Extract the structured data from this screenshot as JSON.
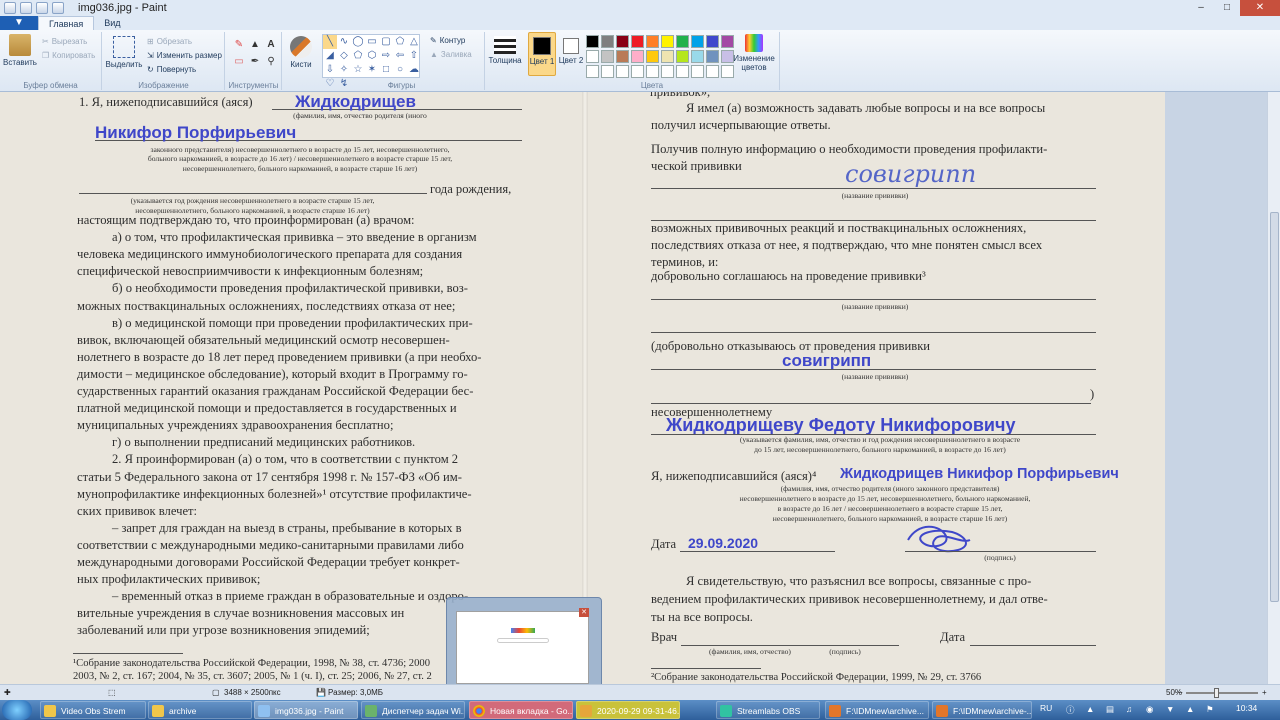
{
  "window": {
    "title": "img036.jpg - Paint",
    "tabs": [
      "Главная",
      "Вид"
    ]
  },
  "ribbon": {
    "clipboard": {
      "paste": "Вставить",
      "cut": "Вырезать",
      "copy": "Копировать",
      "label": "Буфер обмена"
    },
    "image": {
      "select": "Выделить",
      "crop": "Обрезать",
      "resize": "Изменить размер",
      "rotate": "Повернуть",
      "label": "Изображение"
    },
    "tools": {
      "label": "Инструменты"
    },
    "brushes": {
      "label": "Кисти"
    },
    "shapes": {
      "outline": "Контур",
      "fill": "Заливка",
      "label": "Фигуры"
    },
    "size": {
      "label": "Толщина"
    },
    "colors": {
      "color1": "Цвет 1",
      "color2": "Цвет 2",
      "edit": "Изменение цветов",
      "label": "Цвета"
    },
    "palette": [
      "#000000",
      "#7f7f7f",
      "#880015",
      "#ed1c24",
      "#ff7f27",
      "#fff200",
      "#22b14c",
      "#00a2e8",
      "#3f48cc",
      "#a349a4",
      "#ffffff",
      "#c3c3c3",
      "#b97a57",
      "#ffaec9",
      "#ffc90e",
      "#efe4b0",
      "#b5e61d",
      "#99d9ea",
      "#7092be",
      "#c8bfe7",
      "#ffffff",
      "#ffffff",
      "#ffffff",
      "#ffffff",
      "#ffffff",
      "#ffffff",
      "#ffffff",
      "#ffffff",
      "#ffffff",
      "#ffffff"
    ]
  },
  "document": {
    "left": {
      "line1": "1. Я, нижеподписавшийся (аяся)",
      "hw_surname": "Жидкодрищев",
      "hw_name": "Никифор  Порфирьевич",
      "cap1a": "(фамилия, имя, отчество родителя (иного",
      "cap1b": "законного представителя) несовершеннолетнего в возрасте до 15 лет, несовершеннолетнего,",
      "cap1c": "больного наркоманией, в возрасте до 16 лет) / несовершеннолетнего в возрасте старше 15 лет,",
      "cap1d": "несовершеннолетнего, больного наркоманией, в возрасте старше 16 лет)",
      "birth": "года рождения,",
      "cap2a": "(указывается год рождения несовершеннолетнего в возрасте старше 15 лет,",
      "cap2b": "несовершеннолетнего, больного наркоманией, в возрасте старше 16 лет)",
      "body": [
        "настоящим подтверждаю то, что проинформирован (а) врачом:",
        "а) о том, что профилактическая прививка – это введение в организм",
        "человека медицинского иммунобиологического препарата для создания",
        "специфической невосприимчивости к инфекционным болезням;",
        "б) о необходимости проведения профилактической прививки, воз-",
        "можных поствакцинальных осложнениях, последствиях отказа от нее;",
        "в) о медицинской помощи при проведении профилактических при-",
        "вивок, включающей обязательный медицинский осмотр несовершен-",
        "нолетнего в возрасте до 18 лет перед проведением прививки (а при необхо-",
        "димости – медицинское обследование), который входит в Программу го-",
        "сударственных гарантий оказания гражданам Российской Федерации бес-",
        "платной медицинской помощи и предоставляется в государственных и",
        "муниципальных учреждениях здравоохранения бесплатно;",
        "г) о выполнении предписаний медицинских работников.",
        "2. Я проинформирован (а) о том, что в соответствии с пунктом 2",
        "статьи 5 Федерального закона от 17 сентября 1998 г. № 157-ФЗ «Об им-",
        "мунопрофилактике инфекционных болезней»¹ отсутствие профилактиче-",
        "ских прививок влечет:",
        "– запрет для граждан на выезд в страны, пребывание в которых в",
        "соответствии с международными медико-санитарными правилами либо",
        "международными договорами Российской Федерации требует конкрет-",
        "ных профилактических прививок;",
        "– временный отказ в приеме граждан в образовательные и оздоро-",
        "вительные учреждения в случае возникновения массовых ин",
        "заболеваний или при угрозе возникновения эпидемий;"
      ],
      "foot1": "¹Собрание законодательства Российской Федерации, 1998, № 38, ст. 4736; 2000",
      "foot2": "2003, № 2, ст. 167; 2004, № 35, ст. 3607; 2005, № 1 (ч. I), ст. 25; 2006, № 27, ст. 2"
    },
    "right": {
      "top": "прививок»,",
      "p1a": "Я имел (а) возможность задавать любые вопросы и на все вопросы",
      "p1b": "получил исчерпывающие ответы.",
      "p2a": "Получив полную информацию о необходимости проведения профилакти-",
      "p2b": "ческой прививки",
      "hw_vaccine1": "совигрипп",
      "vac_cap": "(название прививки)",
      "p3a": "возможных прививочных реакций и поствакцинальных осложнениях,",
      "p3b": "последствиях отказа от нее, я подтверждаю, что мне понятен смысл всех",
      "p3c": "терминов, и:",
      "p3d": "добровольно соглашаюсь на проведение прививки³",
      "refuse": "(добровольно отказываюсь от проведения прививки",
      "hw_vaccine2": "совигрипп",
      "close_paren": ")",
      "minor": "несовершеннолетнему",
      "hw_child": "Жидкодрищеву Федоту Никифоровичу",
      "cap_child1": "(указывается фамилия, имя, отчество и год рождения несовершеннолетнего в возрасте",
      "cap_child2": "до 15 лет, несовершеннолетнего, больного наркоманией, в возрасте до 16 лет)",
      "p4": "Я, нижеподписавшийся (аяся)⁴",
      "hw_parent": "Жидкодрищев Никифор Порфирьевич",
      "cap_p1": "(фамилия, имя, отчество родителя (иного законного представителя)",
      "cap_p2": "несовершеннолетнего в возрасте до 15 лет, несовершеннолетнего, больного наркоманией,",
      "cap_p3": "в возрасте до 16 лет / несовершеннолетнего в возрасте старше 15 лет,",
      "cap_p4": "несовершеннолетнего, больного наркоманией, в возрасте старше 16 лет)",
      "date_label": "Дата",
      "hw_date": "29.09.2020",
      "sign_cap": "(подпись)",
      "p5a": "Я свидетельствую, что разъяснил все вопросы, связанные с про-",
      "p5b": "ведением профилактических прививок несовершеннолетнему, и дал отве-",
      "p5c": "ты на все вопросы.",
      "doctor": "Врач",
      "doctor_cap": "(фамилия, имя, отчество)",
      "doctor_sign": "(подпись)",
      "date2": "Дата",
      "foot": "²Собрание законодательства Российской Федерации, 1999, № 29, ст. 3766"
    }
  },
  "status": {
    "dimensions": "3488 × 2500пкс",
    "size": "Размер: 3,0МБ",
    "zoom": "50%"
  },
  "taskbar": {
    "items": [
      "Video Obs Strem",
      "archive",
      "img036.jpg - Paint",
      "Диспетчер задач Wi...",
      "Новая вкладка - Go...",
      "2020-09-29 09-31-46...",
      "Streamlabs OBS",
      "F:\\IDMnew\\archive...",
      "F:\\IDMnew\\archive-..."
    ],
    "lang": "RU",
    "clock": "10:34"
  }
}
